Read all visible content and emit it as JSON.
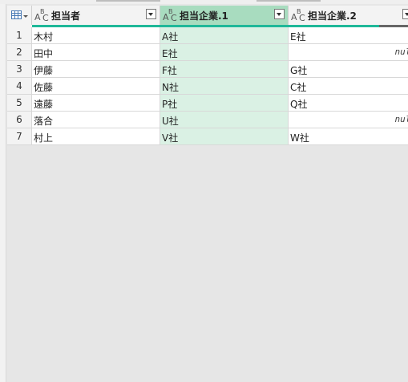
{
  "columns": [
    {
      "name": "担当者",
      "type_icon": "text-type-icon",
      "selected": false
    },
    {
      "name": "担当企業.1",
      "type_icon": "text-type-icon",
      "selected": true
    },
    {
      "name": "担当企業.2",
      "type_icon": "text-type-icon",
      "selected": false
    }
  ],
  "rows": [
    {
      "index": "1",
      "c1": "木村",
      "c2": "A社",
      "c3": "E社"
    },
    {
      "index": "2",
      "c1": "田中",
      "c2": "E社",
      "c3": "null"
    },
    {
      "index": "3",
      "c1": "伊藤",
      "c2": "F社",
      "c3": "G社"
    },
    {
      "index": "4",
      "c1": "佐藤",
      "c2": "N社",
      "c3": "C社"
    },
    {
      "index": "5",
      "c1": "遠藤",
      "c2": "P社",
      "c3": "Q社"
    },
    {
      "index": "6",
      "c1": "落合",
      "c2": "U社",
      "c3": "null"
    },
    {
      "index": "7",
      "c1": "村上",
      "c2": "V社",
      "c3": "W社"
    }
  ],
  "colors": {
    "selected_header": "#a8dcbf",
    "selected_cells": "#daf1e4",
    "quality_bar_valid": "#1fb899",
    "quality_bar_empty": "#666666"
  }
}
